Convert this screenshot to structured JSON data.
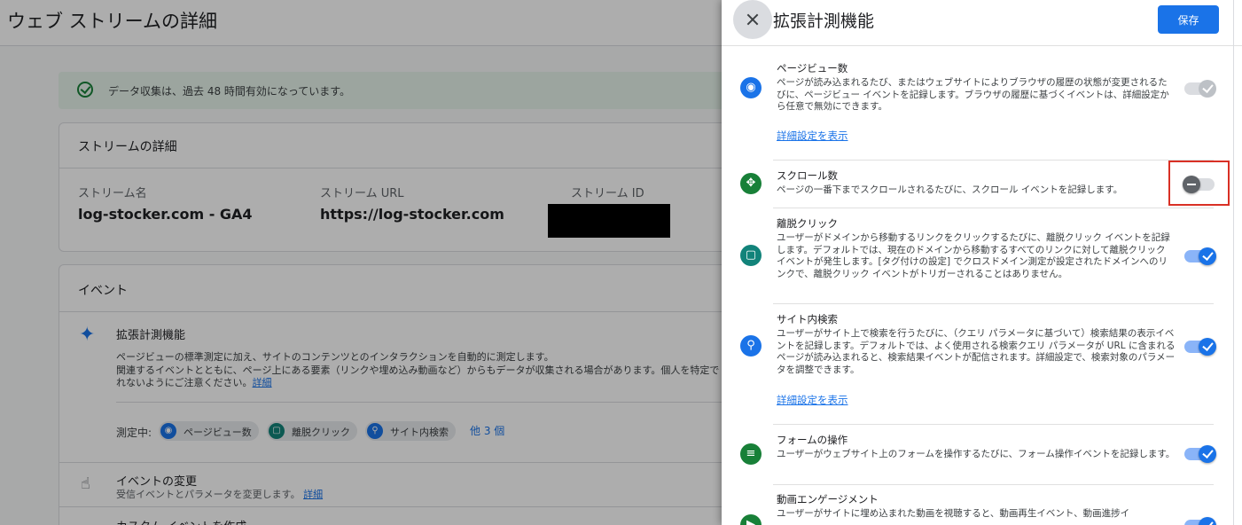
{
  "page": {
    "title": "ウェブ ストリームの詳細",
    "banner": "データ収集は、過去 48 時間有効になっています。",
    "stream_card": {
      "title": "ストリームの詳細",
      "name_label": "ストリーム名",
      "name_value": "log-stocker.com - GA4",
      "url_label": "ストリーム URL",
      "url_value": "https://log-stocker.com",
      "id_label": "ストリーム ID"
    },
    "events_card": {
      "title": "イベント",
      "em_title": "拡張計測機能",
      "em_desc": "ページビューの標準測定に加え、サイトのコンテンツとのインタラクションを自動的に測定します。\n関連するイベントとともに、ページ上にある要素（リンクや埋め込み動画など）からもデータが収集される場合があります。個人を特定で\nれないようにご注意ください。",
      "em_link": "詳細",
      "measuring_label": "測定中:",
      "chips": [
        "ページビュー数",
        "離脱クリック",
        "サイト内検索"
      ],
      "more": "他 3 個",
      "modify_title": "イベントの変更",
      "modify_desc": "受信イベントとパラメータを変更します。",
      "modify_link": "詳細",
      "create_title": "カスタム イベントを作成"
    }
  },
  "drawer": {
    "title": "拡張計測機能",
    "save_label": "保存",
    "settings": [
      {
        "title": "ページビュー数",
        "desc": "ページが読み込まれるたび、またはウェブサイトによりブラウザの履歴の状態が変更されるたびに、ページビュー イベントを記録します。ブラウザの履歴に基づくイベントは、詳細設定から任意で無効にできます。",
        "link": "詳細設定を表示",
        "state": "on-disabled",
        "icon": "eye-icon",
        "icon_color": "#1a73e8"
      },
      {
        "title": "スクロール数",
        "desc": "ページの一番下までスクロールされるたびに、スクロール イベントを記録します。",
        "state": "off",
        "icon": "scroll-icon",
        "icon_color": "#188038"
      },
      {
        "title": "離脱クリック",
        "desc": "ユーザーがドメインから移動するリンクをクリックするたびに、離脱クリック イベントを記録します。デフォルトでは、現在のドメインから移動するすべてのリンクに対して離脱クリック イベントが発生します。[タグ付けの設定] でクロスドメイン測定が設定されたドメインへのリンクで、離脱クリック イベントがトリガーされることはありません。",
        "state": "on",
        "icon": "mouse-icon",
        "icon_color": "#12837a"
      },
      {
        "title": "サイト内検索",
        "desc": "ユーザーがサイト上で検索を行うたびに、（クエリ パラメータに基づいて）検索結果の表示イベントを記録します。デフォルトでは、よく使用される検索クエリ パラメータが URL に含まれるページが読み込まれると、検索結果イベントが配信されます。詳細設定で、検索対象のパラメータを調整できます。",
        "link": "詳細設定を表示",
        "state": "on",
        "icon": "search-icon",
        "icon_color": "#1a73e8"
      },
      {
        "title": "フォームの操作",
        "desc": "ユーザーがウェブサイト上のフォームを操作するたびに、フォーム操作イベントを記録します。",
        "state": "on",
        "icon": "form-icon",
        "icon_color": "#188038"
      },
      {
        "title": "動画エンゲージメント",
        "desc": "ユーザーがサイトに埋め込まれた動画を視聴すると、動画再生イベント、動画進捗イ",
        "state": "on",
        "icon": "video-icon",
        "icon_color": "#188038"
      }
    ]
  },
  "colors": {
    "accent": "#1a73e8",
    "highlight": "#d93025",
    "success": "#188038"
  }
}
